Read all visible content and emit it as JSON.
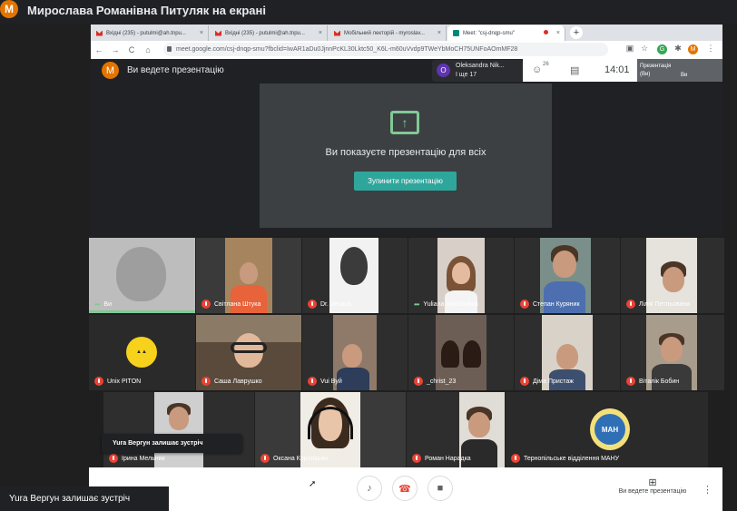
{
  "window": {
    "avatar_letter": "M",
    "title": "Мирослава Романівна Питуляк на екрані"
  },
  "browser": {
    "tabs": [
      "Вхідні (235) - putulmi@ah.tnpu...",
      "Вхідні (235) - putulmi@ah.tnpu...",
      "Мобільний лекторій - myroslav...",
      "Meet: \"csj-dnqp-smu\""
    ],
    "tab_close": "×",
    "new_tab": "+",
    "nav": {
      "back": "←",
      "forward": "→",
      "reload": "C",
      "home": "⌂"
    },
    "url": "meet.google.com/csj-dnqp-smu?fbclid=IwAR1aDu0JjnnPcKL30Lktc50_K6L-m60uVvdp9TWeYbMoCH75UNFoAOmMF28",
    "ext_g": "G",
    "ext_m": "M"
  },
  "meet_header": {
    "avatar_letter": "M",
    "title": "Ви ведете презентацію",
    "presenter_initial": "O",
    "presenter_name": "Oleksandra Nik...",
    "presenter_more": "І ще 17",
    "people_count": "26",
    "time": "14:01",
    "thumb_label_1": "Презентація",
    "thumb_label_2": "(Ви)",
    "thumb_label_3": "Ви"
  },
  "presentation": {
    "message": "Ви показуєте презентацію для всіх",
    "stop_button": "Зупинити презентацію"
  },
  "participants": [
    "Ви",
    "Світлана Штука",
    "Dr. Venaus",
    "Yuliana Voloshchuk",
    "Степан Куряник",
    "Лілія Петльована",
    "Unix PITON",
    "Саша Лаврушко",
    "Vui Вуй",
    "_christ_23",
    "Діма Пристаж",
    "Віталік Бобин",
    "Ірина Мельник",
    "Оксана Коропішан",
    "Роман Нарадка",
    "Тернопільське відділення МАНУ"
  ],
  "toasts": {
    "small": "Yura Вергун залишає зустріч",
    "big": "Yura Вергун залишає зустріч"
  },
  "controls": {
    "present_label": "Ви ведете презентацію"
  }
}
